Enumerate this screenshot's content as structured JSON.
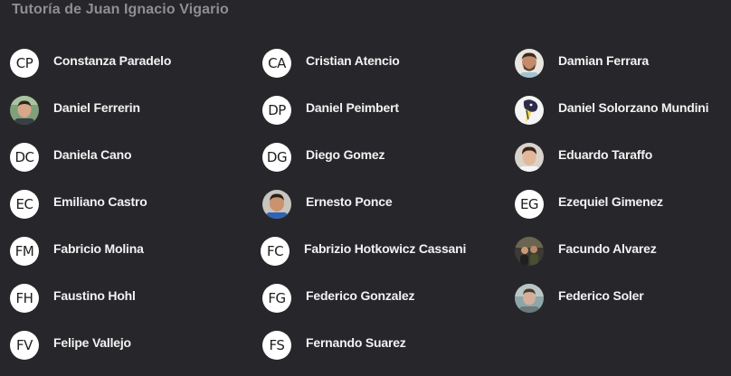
{
  "header": {
    "title": "Tutoría de Juan Ignacio Vigario"
  },
  "members": [
    {
      "name": "Constanza Paradelo",
      "initials": "CP"
    },
    {
      "name": "Cristian Atencio",
      "initials": "CA"
    },
    {
      "name": "Damian Ferrara",
      "photo": "profile-photo"
    },
    {
      "name": "Daniel Ferrerin",
      "photo": "profile-photo"
    },
    {
      "name": "Daniel Peimbert",
      "initials": "DP"
    },
    {
      "name": "Daniel Solorzano Mundini",
      "photo": "illustrated-avatar"
    },
    {
      "name": "Daniela Cano",
      "initials": "DC"
    },
    {
      "name": "Diego Gomez",
      "initials": "DG"
    },
    {
      "name": "Eduardo Taraffo",
      "photo": "profile-photo"
    },
    {
      "name": "Emiliano Castro",
      "initials": "EC"
    },
    {
      "name": "Ernesto Ponce",
      "photo": "profile-photo"
    },
    {
      "name": "Ezequiel Gimenez",
      "initials": "EG"
    },
    {
      "name": "Fabricio Molina",
      "initials": "FM"
    },
    {
      "name": "Fabrizio Hotkowicz Cassani",
      "initials": "FC"
    },
    {
      "name": "Facundo Alvarez",
      "photo": "profile-photo"
    },
    {
      "name": "Faustino Hohl",
      "initials": "FH"
    },
    {
      "name": "Federico Gonzalez",
      "initials": "FG"
    },
    {
      "name": "Federico Soler",
      "photo": "profile-photo"
    },
    {
      "name": "Felipe Vallejo",
      "initials": "FV"
    },
    {
      "name": "Fernando Suarez",
      "initials": "FS"
    }
  ],
  "colors": {
    "background": "#27272b",
    "title": "#8e8e93",
    "name": "#f2f2f2",
    "initials_bg": "#ffffff",
    "initials_text": "#1e1e1e"
  }
}
